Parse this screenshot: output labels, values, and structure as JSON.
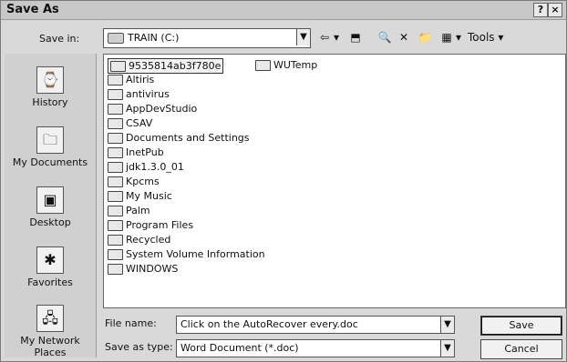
{
  "window": {
    "title": "Save As",
    "help_glyph": "?",
    "close_glyph": "×"
  },
  "save_in": {
    "label": "Save in:",
    "value": "TRAIN (C:)"
  },
  "toolbar": {
    "back_glyph": "⇦",
    "back_menu_glyph": "▾",
    "up_glyph": "⬒",
    "search_glyph": "🔍",
    "delete_glyph": "✕",
    "new_folder_glyph": "📁",
    "views_glyph": "▦",
    "views_menu_glyph": "▾",
    "tools_label": "Tools ▾"
  },
  "places": [
    {
      "label": "History",
      "icon": "history-icon",
      "glyph": "⌚"
    },
    {
      "label": "My Documents",
      "icon": "my-documents-icon",
      "glyph": "🗀"
    },
    {
      "label": "Desktop",
      "icon": "desktop-icon",
      "glyph": "▣"
    },
    {
      "label": "Favorites",
      "icon": "favorites-icon",
      "glyph": "✱"
    },
    {
      "label": "My Network Places",
      "icon": "network-places-icon",
      "glyph": "🖧"
    }
  ],
  "files": [
    {
      "name": "9535814ab3f780e",
      "col": 0,
      "row": 0,
      "type": "folder"
    },
    {
      "name": "Altiris",
      "col": 0,
      "row": 1,
      "type": "folder"
    },
    {
      "name": "antivirus",
      "col": 0,
      "row": 2,
      "type": "folder"
    },
    {
      "name": "AppDevStudio",
      "col": 0,
      "row": 3,
      "type": "folder"
    },
    {
      "name": "CSAV",
      "col": 0,
      "row": 4,
      "type": "folder"
    },
    {
      "name": "Documents and Settings",
      "col": 0,
      "row": 5,
      "type": "folder"
    },
    {
      "name": "InetPub",
      "col": 0,
      "row": 6,
      "type": "folder"
    },
    {
      "name": "jdk1.3.0_01",
      "col": 0,
      "row": 7,
      "type": "folder"
    },
    {
      "name": "Kpcms",
      "col": 0,
      "row": 8,
      "type": "folder"
    },
    {
      "name": "My Music",
      "col": 0,
      "row": 9,
      "type": "folder"
    },
    {
      "name": "Palm",
      "col": 0,
      "row": 10,
      "type": "folder"
    },
    {
      "name": "Program Files",
      "col": 0,
      "row": 11,
      "type": "folder"
    },
    {
      "name": "Recycled",
      "col": 0,
      "row": 12,
      "type": "folder"
    },
    {
      "name": "System Volume Information",
      "col": 0,
      "row": 13,
      "type": "folder"
    },
    {
      "name": "WINDOWS",
      "col": 0,
      "row": 14,
      "type": "folder"
    },
    {
      "name": "WUTemp",
      "col": 1,
      "row": 0,
      "type": "folder"
    }
  ],
  "file_name": {
    "label": "File name:",
    "value": "Click on the AutoRecover every.doc"
  },
  "save_as_type": {
    "label": "Save as type:",
    "value": "Word Document (*.doc)"
  },
  "buttons": {
    "save": "Save",
    "cancel": "Cancel"
  }
}
